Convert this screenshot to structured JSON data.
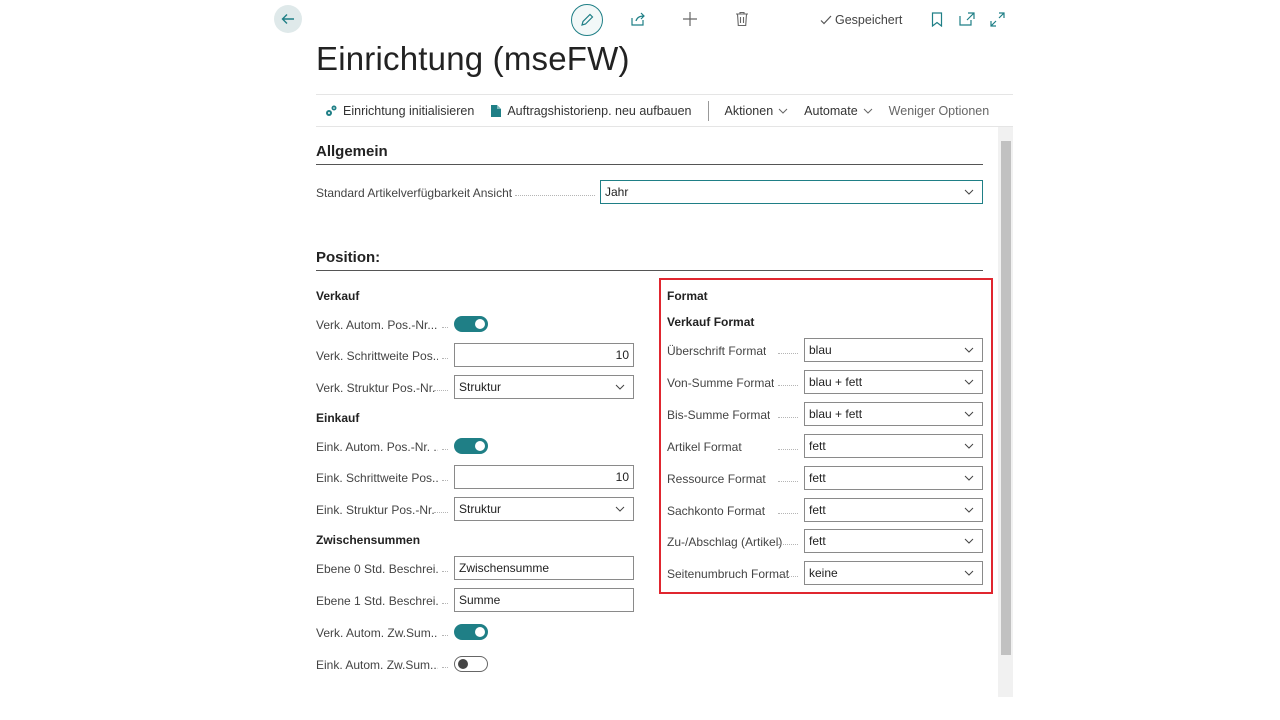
{
  "header": {
    "saved_label": "Gespeichert",
    "title": "Einrichtung (mseFW)"
  },
  "actions": {
    "init_label": "Einrichtung initialisieren",
    "rebuild_label": "Auftragshistorienp. neu aufbauen",
    "actions_label": "Aktionen",
    "automate_label": "Automate",
    "fewer_label": "Weniger Optionen"
  },
  "general": {
    "title": "Allgemein",
    "availability_label": "Standard Artikelverfügbarkeit Ansicht",
    "availability_value": "Jahr"
  },
  "position": {
    "title": "Position:",
    "sales": {
      "head": "Verkauf",
      "auto_label": "Verk. Autom. Pos.-Nr....",
      "auto_on": true,
      "step_label": "Verk. Schrittweite Pos....",
      "step_value": "10",
      "structure_label": "Verk. Struktur Pos.-Nr.",
      "structure_value": "Struktur"
    },
    "purchase": {
      "head": "Einkauf",
      "auto_label": "Eink. Autom. Pos.-Nr. ...",
      "auto_on": true,
      "step_label": "Eink. Schrittweite Pos....",
      "step_value": "10",
      "structure_label": "Eink. Struktur Pos.-Nr.",
      "structure_value": "Struktur"
    },
    "subtotals": {
      "head": "Zwischensummen",
      "level0_label": "Ebene 0 Std. Beschrei...",
      "level0_value": "Zwischensumme",
      "level1_label": "Ebene 1 Std. Beschrei...",
      "level1_value": "Summe",
      "sales_auto_label": "Verk. Autom. Zw.Sum....",
      "sales_auto_on": true,
      "purchase_auto_label": "Eink. Autom. Zw.Sum....",
      "purchase_auto_on": false
    },
    "format": {
      "head": "Format",
      "sub_head": "Verkauf Format",
      "rows": [
        {
          "label": "Überschrift Format",
          "value": "blau"
        },
        {
          "label": "Von-Summe Format",
          "value": "blau + fett"
        },
        {
          "label": "Bis-Summe Format",
          "value": "blau + fett"
        },
        {
          "label": "Artikel Format",
          "value": "fett"
        },
        {
          "label": "Ressource Format",
          "value": "fett"
        },
        {
          "label": "Sachkonto Format",
          "value": "fett"
        },
        {
          "label": "Zu-/Abschlag (Artikel)",
          "value": "fett"
        },
        {
          "label": "Seitenumbruch Format",
          "value": "keine"
        }
      ]
    }
  },
  "colors": {
    "accent": "#1f7f86",
    "highlight_border": "#e0262f"
  },
  "icons": [
    "back-arrow-icon",
    "edit-icon",
    "share-icon",
    "add-icon",
    "delete-icon",
    "checkmark-icon",
    "bookmark-icon",
    "open-new-window-icon",
    "expand-icon",
    "chevron-down-icon"
  ]
}
